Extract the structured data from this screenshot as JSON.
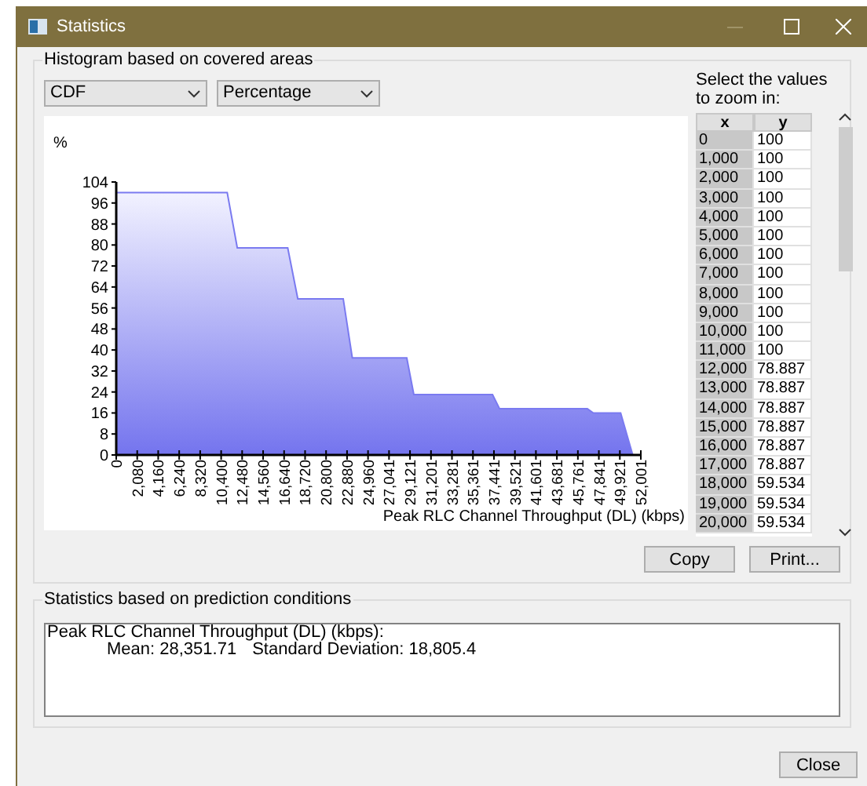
{
  "window": {
    "title": "Statistics"
  },
  "histogram": {
    "title": "Histogram based on covered areas",
    "type_select": {
      "value": "CDF"
    },
    "unit_select": {
      "value": "Percentage"
    },
    "chart_data": {
      "type": "area",
      "ylabel": "%",
      "xlabel": "Peak RLC Channel Throughput (DL) (kbps)",
      "x": [
        0,
        11000,
        12000,
        17000,
        18000,
        22500,
        23400,
        28800,
        29500,
        37300,
        38000,
        46700,
        47300,
        50000,
        51200
      ],
      "series": [
        {
          "color": "#7a7af0",
          "values": [
            100,
            100,
            78.9,
            78.9,
            59.5,
            59.5,
            37,
            37,
            23,
            23,
            17.6,
            17.6,
            16,
            16,
            0
          ]
        }
      ],
      "xlim": [
        0,
        52001
      ],
      "ylim": [
        0,
        104
      ],
      "yticks": [
        0,
        8,
        16,
        24,
        32,
        40,
        48,
        56,
        64,
        72,
        80,
        88,
        96,
        104
      ],
      "xticks": [
        0,
        {
          "value": 2080,
          "label": "2,080"
        },
        {
          "value": 4160,
          "label": "4,160"
        },
        {
          "value": 6240,
          "label": "6,240"
        },
        {
          "value": 8320,
          "label": "8,320"
        },
        {
          "value": 10400,
          "label": "10,400"
        },
        {
          "value": 12480,
          "label": "12,480"
        },
        {
          "value": 14560,
          "label": "14,560"
        },
        {
          "value": 16640,
          "label": "16,640"
        },
        {
          "value": 18720,
          "label": "18,720"
        },
        {
          "value": 20800,
          "label": "20,800"
        },
        {
          "value": 22880,
          "label": "22,880"
        },
        {
          "value": 24960,
          "label": "24,960"
        },
        {
          "value": 27041,
          "label": "27,041"
        },
        {
          "value": 29121,
          "label": "29,121"
        },
        {
          "value": 31201,
          "label": "31,201"
        },
        {
          "value": 33281,
          "label": "33,281"
        },
        {
          "value": 35361,
          "label": "35,361"
        },
        {
          "value": 37441,
          "label": "37,441"
        },
        {
          "value": 39521,
          "label": "39,521"
        },
        {
          "value": 41601,
          "label": "41,601"
        },
        {
          "value": 43681,
          "label": "43,681"
        },
        {
          "value": 45761,
          "label": "45,761"
        },
        {
          "value": 47841,
          "label": "47,841"
        },
        {
          "value": 49921,
          "label": "49,921"
        },
        {
          "value": 52001,
          "label": "52,001"
        }
      ]
    },
    "zoom_label": "Select the values to zoom in:",
    "table": {
      "columns": [
        "x",
        "y"
      ],
      "rows": [
        [
          "0",
          "100"
        ],
        [
          "1,000",
          "100"
        ],
        [
          "2,000",
          "100"
        ],
        [
          "3,000",
          "100"
        ],
        [
          "4,000",
          "100"
        ],
        [
          "5,000",
          "100"
        ],
        [
          "6,000",
          "100"
        ],
        [
          "7,000",
          "100"
        ],
        [
          "8,000",
          "100"
        ],
        [
          "9,000",
          "100"
        ],
        [
          "10,000",
          "100"
        ],
        [
          "11,000",
          "100"
        ],
        [
          "12,000",
          "78.887"
        ],
        [
          "13,000",
          "78.887"
        ],
        [
          "14,000",
          "78.887"
        ],
        [
          "15,000",
          "78.887"
        ],
        [
          "16,000",
          "78.887"
        ],
        [
          "17,000",
          "78.887"
        ],
        [
          "18,000",
          "59.534"
        ],
        [
          "19,000",
          "59.534"
        ],
        [
          "20,000",
          "59.534"
        ]
      ]
    },
    "buttons": [
      "Copy",
      "Print..."
    ]
  },
  "statistics": {
    "title": "Statistics based on prediction conditions",
    "heading": "Peak RLC Channel Throughput (DL) (kbps):",
    "mean": "Mean: 28,351.71",
    "std_dev": "Standard Deviation: 18,805.4"
  },
  "close_button": "Close"
}
